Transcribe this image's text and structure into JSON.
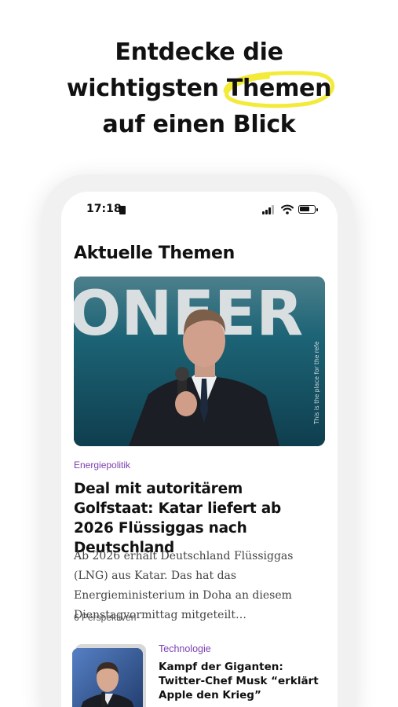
{
  "headline": {
    "line1": "Entdecke die",
    "line2_prefix": "wichtigsten ",
    "line2_highlight": "Themen",
    "line3": "auf einen Blick",
    "highlight_color": "#f3ea3a"
  },
  "status_bar": {
    "time": "17:18",
    "battery_level": 0.7,
    "icons": [
      "sim-card-icon",
      "cellular-signal-icon",
      "wifi-icon",
      "battery-icon"
    ]
  },
  "section": {
    "title": "Aktuelle Themen"
  },
  "main_article": {
    "image_watermark": "This is the place for the refe",
    "image_background_text": "ONFER",
    "category": "Energiepolitik",
    "category_color": "#7b3fb0",
    "title": "Deal mit autoritärem Golfstaat: Katar liefert ab 2026 Flüssiggas nach Deutschland",
    "teaser": "Ab 2026 erhält Deutschland Flüssiggas (LNG) aus Katar. Das hat das Energieministerium in Doha an diesem Dienstagvormittag mitgeteilt…",
    "perspectives": "6 Perspektiven"
  },
  "second_article": {
    "category": "Technologie",
    "title": "Kampf der Giganten: Twitter-Chef Musk “erklärt Apple den Krieg”"
  }
}
